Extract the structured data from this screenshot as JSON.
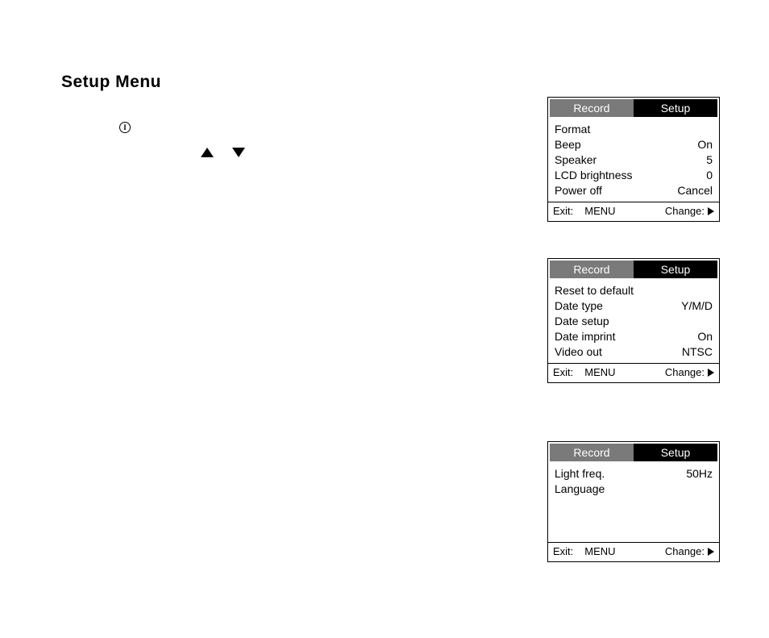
{
  "title": "Setup Menu",
  "icon_glyph": "I",
  "tabs": {
    "record": "Record",
    "setup": "Setup"
  },
  "footer": {
    "exit_label": "Exit:",
    "exit_value": "MENU",
    "change_label": "Change:"
  },
  "panels": [
    {
      "items": [
        {
          "label": "Format",
          "value": ""
        },
        {
          "label": "Beep",
          "value": "On"
        },
        {
          "label": "Speaker",
          "value": "5"
        },
        {
          "label": "LCD brightness",
          "value": "0"
        },
        {
          "label": "Power off",
          "value": "Cancel"
        }
      ]
    },
    {
      "items": [
        {
          "label": "Reset to default",
          "value": ""
        },
        {
          "label": "Date type",
          "value": "Y/M/D"
        },
        {
          "label": "Date setup",
          "value": ""
        },
        {
          "label": "Date imprint",
          "value": "On"
        },
        {
          "label": "Video out",
          "value": "NTSC"
        }
      ]
    },
    {
      "items": [
        {
          "label": "Light freq.",
          "value": "50Hz"
        },
        {
          "label": "Language",
          "value": ""
        }
      ]
    }
  ]
}
